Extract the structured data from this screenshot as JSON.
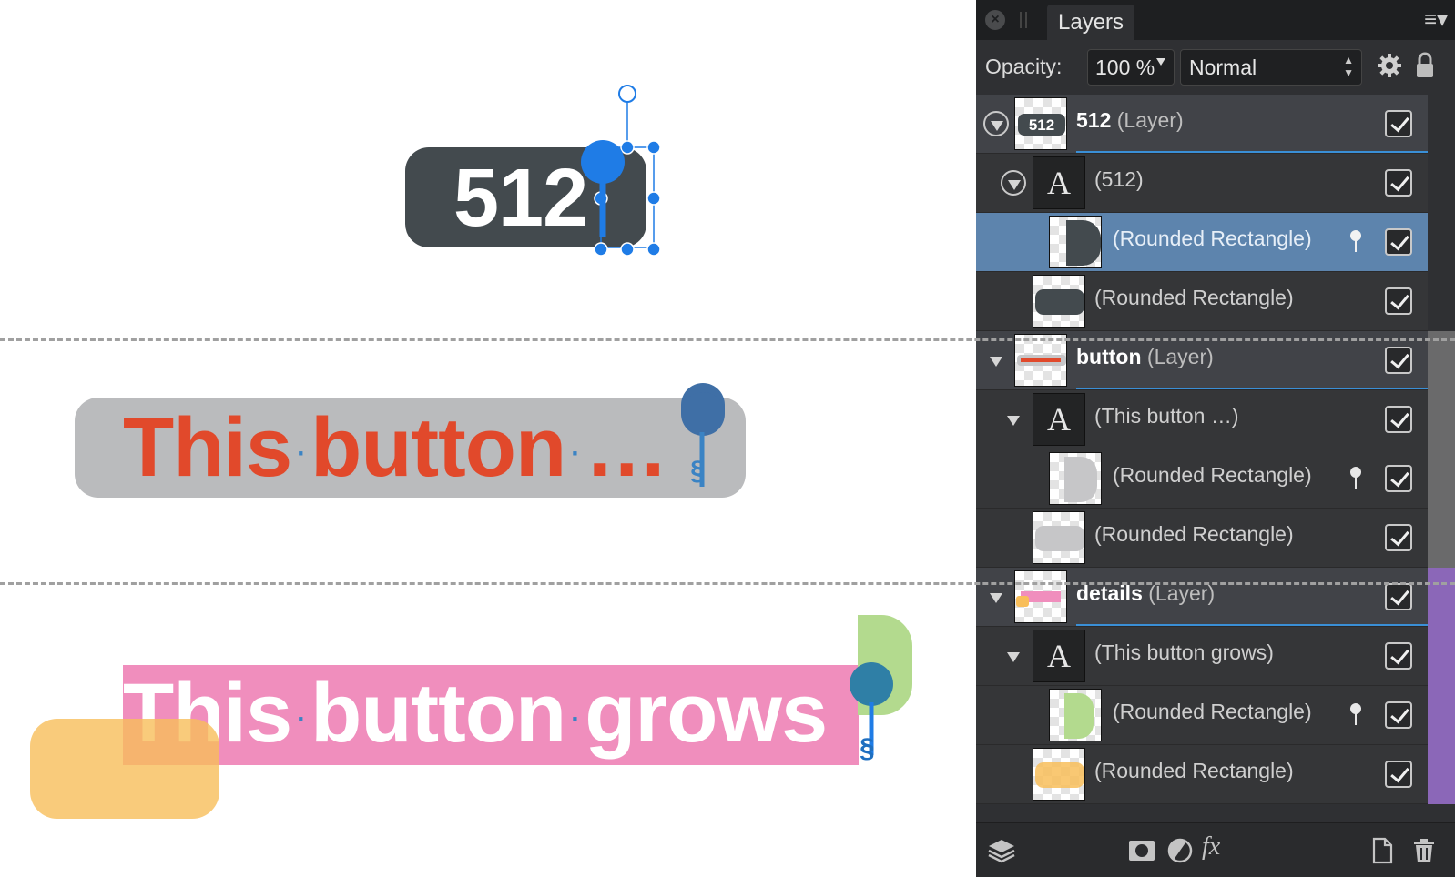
{
  "canvas": {
    "badge_text": "512",
    "gray_button_text": [
      "This",
      "button",
      "…"
    ],
    "pink_button_text": [
      "This",
      "button",
      "grows"
    ]
  },
  "panel": {
    "tab_label": "Layers",
    "opacity_label": "Opacity:",
    "opacity_value": "100 %",
    "blend_mode": "Normal",
    "icons": [
      "close-icon",
      "panel-menu-icon",
      "gear-icon",
      "lock-icon"
    ]
  },
  "layers": [
    {
      "name": "512",
      "kind": "(Layer)",
      "visible": true
    },
    {
      "name": "(512)",
      "visible": true
    },
    {
      "name": "(Rounded Rectangle)",
      "visible": true,
      "selected": true,
      "pinned": true
    },
    {
      "name": "(Rounded Rectangle)",
      "visible": true
    },
    {
      "name": "button",
      "kind": "(Layer)",
      "visible": true
    },
    {
      "name": "(This button …)",
      "visible": true
    },
    {
      "name": "(Rounded Rectangle)",
      "visible": true,
      "pinned": true
    },
    {
      "name": "(Rounded Rectangle)",
      "visible": true
    },
    {
      "name": "details",
      "kind": "(Layer)",
      "visible": true
    },
    {
      "name": "(This button grows)",
      "visible": true
    },
    {
      "name": "(Rounded Rectangle)",
      "visible": true,
      "pinned": true
    },
    {
      "name": "(Rounded Rectangle)",
      "visible": true
    }
  ],
  "bottom_bar": {
    "icons": [
      "layers-stack-icon",
      "mask-icon",
      "adjustment-icon",
      "fx-icon",
      "new-layer-icon",
      "trash-icon"
    ],
    "fx_label": "fx"
  },
  "colors": {
    "selection_blue": "#1f7ce6",
    "selected_row": "#5d84ad",
    "badge_fill": "#434a4e",
    "gray_button_fill": "#babbbd",
    "gray_button_text": "#e1492b",
    "pink_fill": "#f08ebd",
    "yellow_fill": "#f8be5a",
    "green_fill": "#b3da8e",
    "layer_tag_gray": "#6a6a6b",
    "layer_tag_purple": "#8b67b8"
  }
}
